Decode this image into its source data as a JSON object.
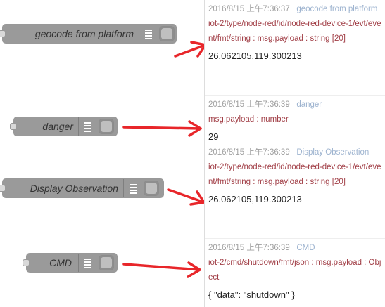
{
  "nodes": [
    {
      "label": "geocode from platform"
    },
    {
      "label": "danger"
    },
    {
      "label": "Display Observation"
    },
    {
      "label": "CMD"
    }
  ],
  "messages": [
    {
      "date": "2016/8/15 上午7:36:37",
      "name": "geocode from platform",
      "topic": "iot-2/type/node-red/id/node-red-device-1/evt/event/fmt/string : msg.payload : string [20]",
      "payload": "26.062105,119.300213"
    },
    {
      "date": "2016/8/15 上午7:36:39",
      "name": "danger",
      "topic": "msg.payload : number",
      "payload": "29"
    },
    {
      "date": "2016/8/15 上午7:36:39",
      "name": "Display Observation",
      "topic": "iot-2/type/node-red/id/node-red-device-1/evt/event/fmt/string : msg.payload : string [20]",
      "payload": "26.062105,119.300213"
    },
    {
      "date": "2016/8/15 上午7:36:39",
      "name": "CMD",
      "topic": "iot-2/cmd/shutdown/fmt/json : msg.payload : Object",
      "payload": "{ \"data\": \"shutdown\" }"
    }
  ],
  "colors": {
    "node_fill": "#9a9a9a",
    "arrow": "#e8262a",
    "topic": "#a13e46",
    "node_name": "#9db3cf"
  }
}
